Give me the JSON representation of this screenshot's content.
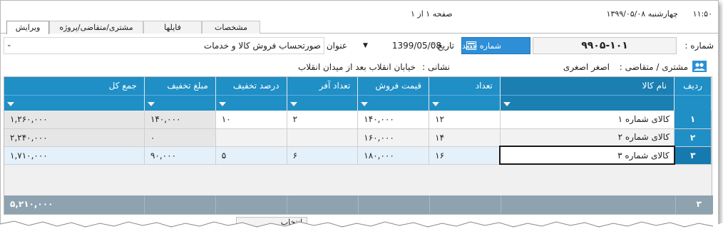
{
  "topbar": {
    "time": "۱۱:۵۰",
    "date_text": "چهارشنبه  ۱۳۹۹/۰۵/۰۸",
    "page_info": "صفحه ۱ از ۱"
  },
  "tabs": [
    {
      "label": "ویرایش"
    },
    {
      "label": "مشتری/متقاضی/پروژه"
    },
    {
      "label": "فایلها"
    },
    {
      "label": "مشخصات"
    }
  ],
  "header": {
    "number_label": "شماره :",
    "number_value": "۹۹۰۵-۱۰۱",
    "new_number_button": "شماره جدید",
    "date_label": "تاریخ :",
    "date_value": "1399/05/08",
    "title_label": "عنوان :",
    "title_value": "صورتحساب فروش کالا و خدمات",
    "customer_label": "مشتری / متقاضی :",
    "customer_value": "اصغر اصغری",
    "address_label": "نشانی :",
    "address_value": "خیابان انقلاب بعد از میدان انقلاب"
  },
  "grid": {
    "columns": [
      "ردیف",
      "نام کالا",
      "تعداد",
      "قیمت فروش",
      "تعداد آفر",
      "درصد تخفیف",
      "مبلغ تخفیف",
      "جمع کل"
    ],
    "rows": [
      {
        "index": "۱",
        "name": "کالای شماره ۱",
        "qty": "۱۲",
        "price": "۱۴۰,۰۰۰",
        "offer": "۲",
        "discount_pct": "۱۰",
        "discount_amt": "۱۴۰,۰۰۰",
        "total": "۱,۲۶۰,۰۰۰"
      },
      {
        "index": "۲",
        "name": "کالای شماره ۲",
        "qty": "۱۴",
        "price": "۱۶۰,۰۰۰",
        "offer": "",
        "discount_pct": "",
        "discount_amt": "۰",
        "total": "۲,۲۴۰,۰۰۰"
      },
      {
        "index": "۳",
        "name": "کالای شماره ۳",
        "qty": "۱۶",
        "price": "۱۸۰,۰۰۰",
        "offer": "۶",
        "discount_pct": "۵",
        "discount_amt": "۹۰,۰۰۰",
        "total": "۱,۷۱۰,۰۰۰"
      }
    ],
    "summary": {
      "count": "۳",
      "total": "۵,۲۱۰,۰۰۰"
    }
  },
  "bottom_tab": {
    "label": "انتخاب"
  },
  "colors": {
    "accent": "#1f8fc6",
    "button": "#2f8fd6",
    "summary": "#8ea2b0"
  }
}
